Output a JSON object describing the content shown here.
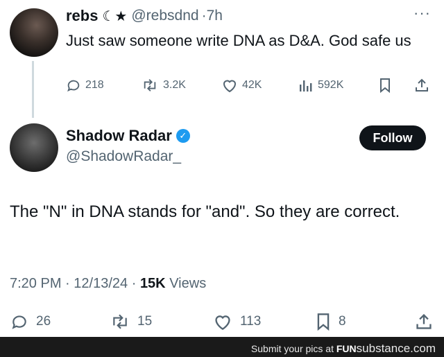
{
  "tweet1": {
    "name": "rebs",
    "name_emoji": "☾★",
    "handle": "@rebsdnd",
    "separator": "·",
    "time": "7h",
    "more": "···",
    "text": "Just saw someone write DNA as D&A. God safe us",
    "replies": "218",
    "reposts": "3.2K",
    "likes": "42K",
    "views": "592K"
  },
  "tweet2": {
    "name": "Shadow Radar",
    "verified_mark": "✓",
    "handle": "@ShadowRadar_",
    "follow_label": "Follow",
    "text": "The \"N\" in DNA stands for \"and\". So they are correct.",
    "time": "7:20 PM",
    "date": "12/13/24",
    "separator": "·",
    "views_count": "15K",
    "views_label": "Views",
    "replies": "26",
    "reposts": "15",
    "likes": "113",
    "bookmarks": "8"
  },
  "footer": {
    "text": "Submit your pics at",
    "brand_fun": "FUN",
    "brand_rest": "substance.com"
  },
  "colors": {
    "text": "#0f1419",
    "muted": "#536471",
    "verified": "#1d9bf0",
    "follow_bg": "#0f1419",
    "footer_bg": "#1a1a1a"
  }
}
